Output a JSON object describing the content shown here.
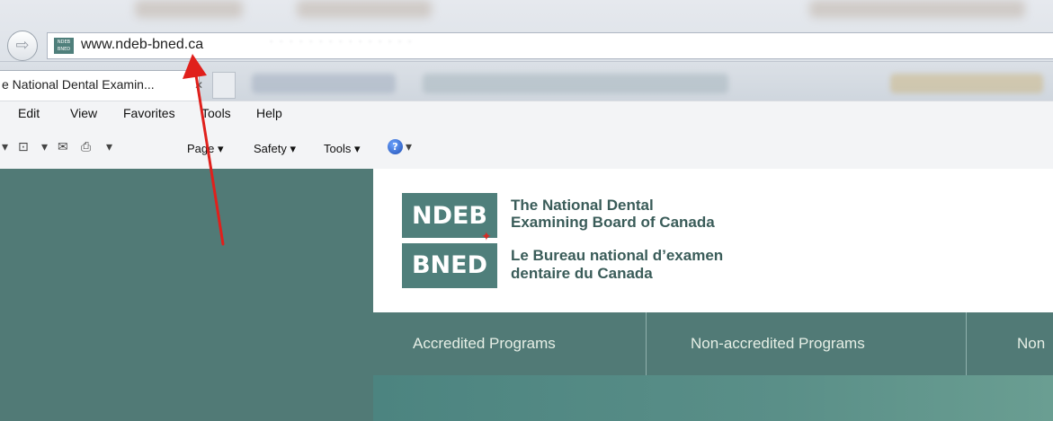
{
  "browser": {
    "address_url": "www.ndeb-bned.ca",
    "favicon_text": "NDEB BNED",
    "tab_title": "e National Dental Examin...",
    "tab_close": "✕",
    "back_icon": "back-arrow-icon",
    "menu": [
      "Edit",
      "View",
      "Favorites",
      "Tools",
      "Help"
    ],
    "commands": {
      "page": "Page ▾",
      "safety": "Safety ▾",
      "tools": "Tools ▾",
      "help": "?"
    }
  },
  "site": {
    "logo_top": "NDEB",
    "logo_bottom": "BNED",
    "name_en_1": "The National Dental",
    "name_en_2": "Examining Board of Canada",
    "name_fr_1": "Le Bureau national d’examen",
    "name_fr_2": "dentaire du Canada",
    "nav": [
      "Accredited Programs",
      "Non-accredited Programs",
      "Non"
    ]
  },
  "colors": {
    "brand_teal": "#517a76",
    "logo_teal": "#4f7f7b",
    "annotation_arrow": "#e0201c",
    "maple_leaf": "#d62b25"
  }
}
